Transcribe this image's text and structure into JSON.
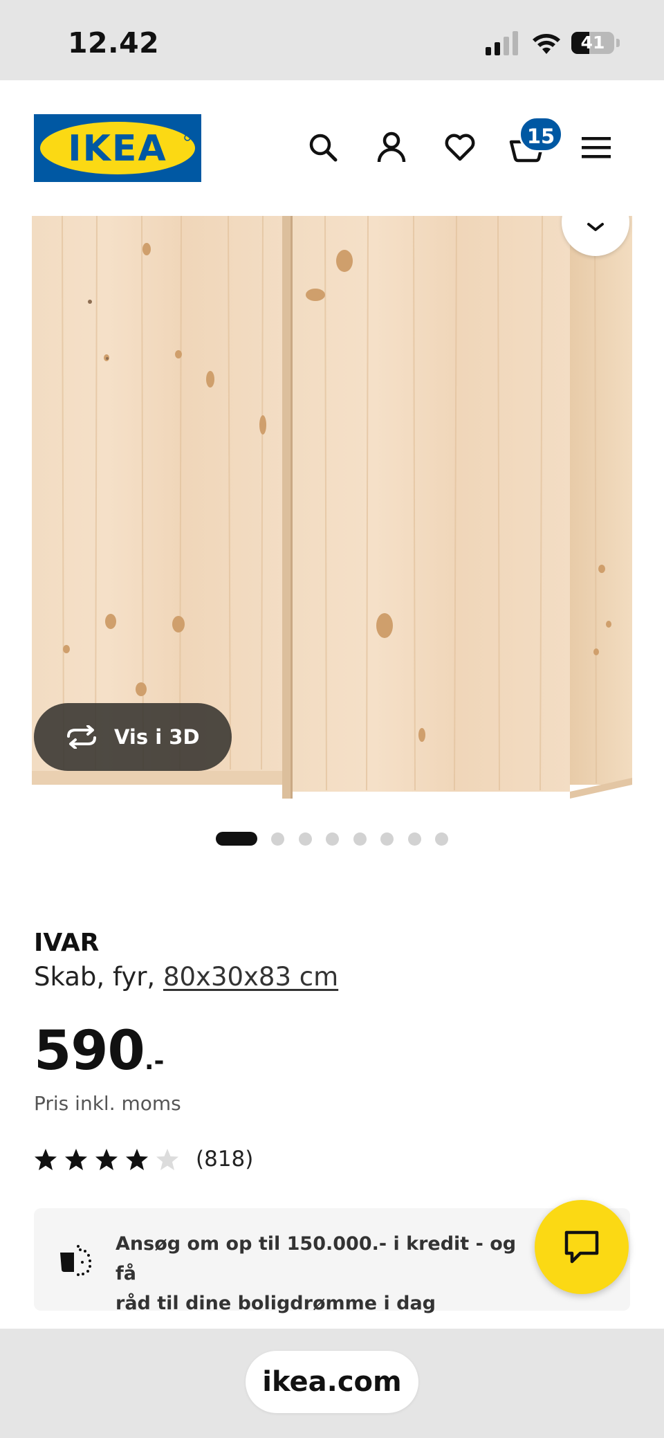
{
  "status_bar": {
    "time": "12.42",
    "battery_level": "41",
    "icons": [
      "signal-icon",
      "wifi-icon",
      "battery-icon"
    ]
  },
  "header": {
    "logo_text": "IKEA",
    "icons": [
      "search-icon",
      "account-icon",
      "heart-icon",
      "cart-icon",
      "menu-icon"
    ],
    "cart_count": "15",
    "colors": {
      "brand_blue": "#0058a3",
      "brand_yellow": "#fbd914"
    }
  },
  "gallery": {
    "view_3d_label": "Vis i 3D",
    "image_count": 8,
    "active_index": 0
  },
  "product": {
    "name": "IVAR",
    "type": "Skab, fyr,",
    "dimensions": "80x30x83 cm",
    "price_integer": "590",
    "price_suffix": ".-",
    "price_note": "Pris inkl. moms",
    "rating_value": 4,
    "rating_max": 5,
    "review_count": "(818)"
  },
  "credit_banner": {
    "line1": "Ansøg om op til 150.000.- i kredit - og få",
    "line2": "råd til dine boligdrømme i dag"
  },
  "browser": {
    "url": "ikea.com"
  }
}
